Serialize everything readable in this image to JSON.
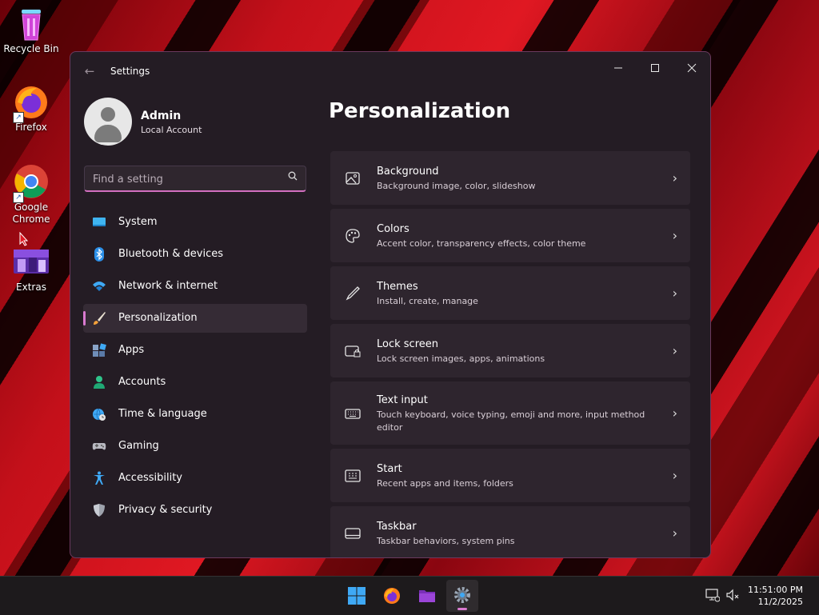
{
  "desktop": {
    "icons": [
      {
        "label": "Recycle Bin"
      },
      {
        "label": "Firefox"
      },
      {
        "label": "Google Chrome"
      },
      {
        "label": "Extras"
      }
    ]
  },
  "window": {
    "title": "Settings",
    "controls": {
      "minimize": "minimize-icon",
      "maximize": "maximize-icon",
      "close": "close-icon"
    }
  },
  "profile": {
    "name": "Admin",
    "account_type": "Local Account"
  },
  "search": {
    "placeholder": "Find a setting"
  },
  "nav": {
    "items": [
      {
        "label": "System",
        "icon": "monitor-icon"
      },
      {
        "label": "Bluetooth & devices",
        "icon": "bluetooth-icon"
      },
      {
        "label": "Network & internet",
        "icon": "wifi-icon"
      },
      {
        "label": "Personalization",
        "icon": "brush-icon",
        "active": true
      },
      {
        "label": "Apps",
        "icon": "apps-icon"
      },
      {
        "label": "Accounts",
        "icon": "person-icon"
      },
      {
        "label": "Time & language",
        "icon": "globe-clock-icon"
      },
      {
        "label": "Gaming",
        "icon": "gamepad-icon"
      },
      {
        "label": "Accessibility",
        "icon": "accessibility-icon"
      },
      {
        "label": "Privacy & security",
        "icon": "shield-icon"
      }
    ]
  },
  "main": {
    "title": "Personalization",
    "cards": [
      {
        "title": "Background",
        "subtitle": "Background image, color, slideshow",
        "icon": "image-icon"
      },
      {
        "title": "Colors",
        "subtitle": "Accent color, transparency effects, color theme",
        "icon": "palette-icon"
      },
      {
        "title": "Themes",
        "subtitle": "Install, create, manage",
        "icon": "pen-icon"
      },
      {
        "title": "Lock screen",
        "subtitle": "Lock screen images, apps, animations",
        "icon": "lock-screen-icon"
      },
      {
        "title": "Text input",
        "subtitle": "Touch keyboard, voice typing, emoji and more, input method editor",
        "icon": "keyboard-icon"
      },
      {
        "title": "Start",
        "subtitle": "Recent apps and items, folders",
        "icon": "start-icon"
      },
      {
        "title": "Taskbar",
        "subtitle": "Taskbar behaviors, system pins",
        "icon": "taskbar-icon"
      }
    ]
  },
  "taskbar": {
    "apps": [
      "start-icon",
      "firefox-icon",
      "file-explorer-icon",
      "settings-icon"
    ],
    "time": "11:51:00 PM",
    "date": "11/2/2025"
  },
  "colors": {
    "accent": "#d97ad0",
    "window_bg": "#241c24",
    "card_bg": "#2e252e"
  }
}
